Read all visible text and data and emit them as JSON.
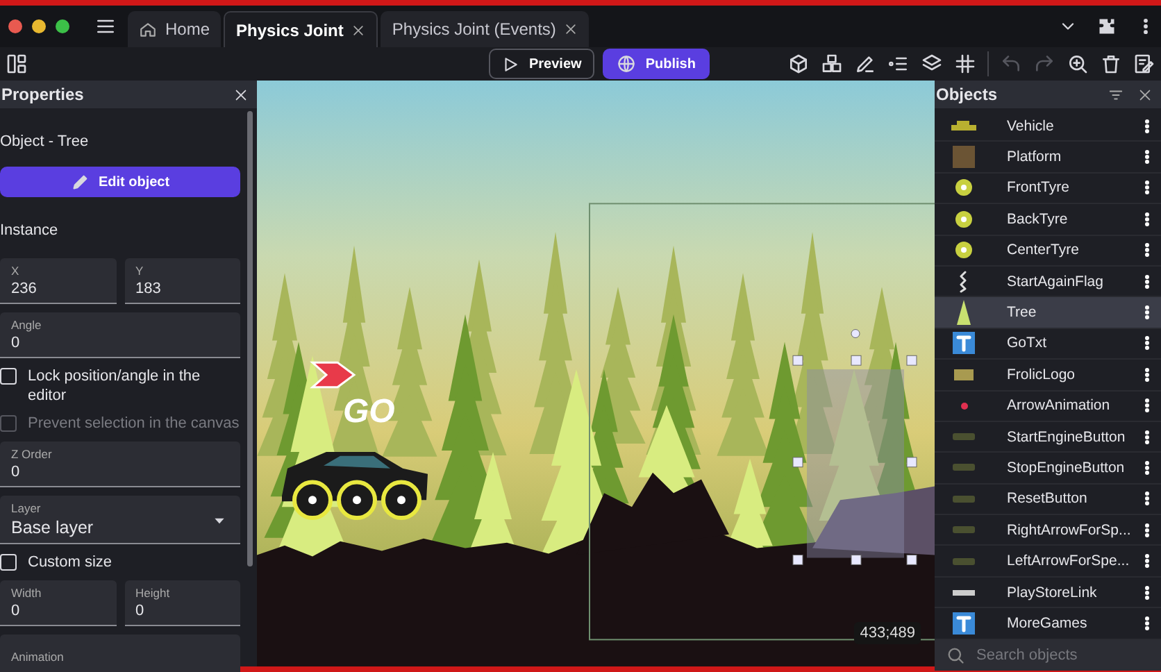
{
  "window_controls": [
    {
      "kind": "close"
    },
    {
      "kind": "minimize"
    },
    {
      "kind": "maximize"
    }
  ],
  "tabs": [
    {
      "label": "Home",
      "kind": "home",
      "closable": false,
      "selected": false
    },
    {
      "label": "Physics Joint",
      "kind": "scene",
      "closable": true,
      "selected": true
    },
    {
      "label": "Physics Joint (Events)",
      "kind": "scene",
      "closable": true,
      "selected": false
    }
  ],
  "toolbar": {
    "preview": "Preview",
    "publish": "Publish",
    "tools": [
      {
        "kind": "cube",
        "disabled": false
      },
      {
        "kind": "cubes",
        "disabled": false
      },
      {
        "kind": "pencil",
        "disabled": false
      },
      {
        "kind": "list",
        "disabled": false
      },
      {
        "kind": "layers",
        "disabled": false
      },
      {
        "kind": "grid",
        "disabled": false
      },
      {
        "kind": "undo",
        "disabled": true
      },
      {
        "kind": "redo",
        "disabled": true
      },
      {
        "kind": "zoom",
        "disabled": false
      },
      {
        "kind": "trash",
        "disabled": false
      },
      {
        "kind": "edit",
        "disabled": false
      }
    ]
  },
  "properties": {
    "title": "Properties",
    "object_label": "Object  - Tree",
    "edit_button": "Edit object",
    "section": "Instance",
    "fields": [
      {
        "kind": "pair",
        "items": [
          {
            "label": "X",
            "value": "236"
          },
          {
            "label": "Y",
            "value": "183"
          }
        ]
      },
      {
        "kind": "single",
        "items": [
          {
            "label": "Angle",
            "value": "0"
          }
        ]
      },
      {
        "kind": "checkbox",
        "label": "Lock position/angle in the editor",
        "checked": false,
        "disabled": false
      },
      {
        "kind": "checkbox",
        "label": "Prevent selection in the canvas",
        "checked": false,
        "disabled": true
      },
      {
        "kind": "single",
        "items": [
          {
            "label": "Z Order",
            "value": "0"
          }
        ]
      },
      {
        "kind": "select",
        "items": [
          {
            "label": "Layer",
            "value": "Base layer"
          }
        ]
      },
      {
        "kind": "checkbox",
        "label": "Custom size",
        "checked": false,
        "disabled": false
      },
      {
        "kind": "pair",
        "items": [
          {
            "label": "Width",
            "value": "0"
          },
          {
            "label": "Height",
            "value": "0"
          }
        ]
      },
      {
        "kind": "single",
        "items": [
          {
            "label": "Animation",
            "value": ""
          }
        ]
      }
    ]
  },
  "scene": {
    "go_text": "GO",
    "coordinates": "433;489"
  },
  "objects": {
    "title": "Objects",
    "search_placeholder": "Search objects",
    "items": [
      {
        "name": "Vehicle",
        "kind": "vehicle",
        "selected": false
      },
      {
        "name": "Platform",
        "kind": "platform",
        "selected": false
      },
      {
        "name": "FrontTyre",
        "kind": "tyre",
        "selected": false
      },
      {
        "name": "BackTyre",
        "kind": "tyre",
        "selected": false
      },
      {
        "name": "CenterTyre",
        "kind": "tyre",
        "selected": false
      },
      {
        "name": "StartAgainFlag",
        "kind": "flag",
        "selected": false
      },
      {
        "name": "Tree",
        "kind": "tree",
        "selected": true
      },
      {
        "name": "GoTxt",
        "kind": "text",
        "selected": false
      },
      {
        "name": "FrolicLogo",
        "kind": "logo",
        "selected": false
      },
      {
        "name": "ArrowAnimation",
        "kind": "arrow",
        "selected": false
      },
      {
        "name": "StartEngineButton",
        "kind": "button",
        "selected": false
      },
      {
        "name": "StopEngineButton",
        "kind": "button",
        "selected": false
      },
      {
        "name": "ResetButton",
        "kind": "button",
        "selected": false
      },
      {
        "name": "RightArrowForSp...",
        "kind": "button",
        "selected": false
      },
      {
        "name": "LeftArrowForSpe...",
        "kind": "button",
        "selected": false
      },
      {
        "name": "PlayStoreLink",
        "kind": "link",
        "selected": false
      },
      {
        "name": "MoreGames",
        "kind": "text",
        "selected": false
      }
    ]
  }
}
